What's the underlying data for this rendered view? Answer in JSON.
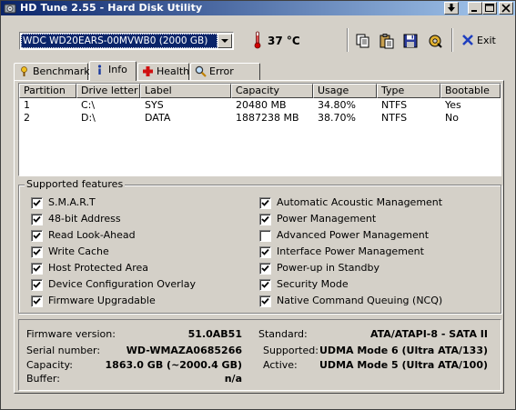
{
  "window": {
    "title": "HD Tune 2.55 - Hard Disk Utility",
    "buttons": [
      "down-arrow",
      "minimize",
      "maximize",
      "close"
    ]
  },
  "toolbar": {
    "drive_selected": "WDC WD20EARS-00MVWB0 (2000 GB)",
    "temperature": "37 °C",
    "exit_label": "Exit"
  },
  "tabs": [
    {
      "label": "Benchmark",
      "icon": "benchmark-icon",
      "active": false
    },
    {
      "label": "Info",
      "icon": "info-icon",
      "active": true
    },
    {
      "label": "Health",
      "icon": "health-cross-icon",
      "active": false
    },
    {
      "label": "Error Scan",
      "icon": "magnifier-icon",
      "active": false
    }
  ],
  "partitions": {
    "columns": [
      "Partition",
      "Drive letter",
      "Label",
      "Capacity",
      "Usage",
      "Type",
      "Bootable"
    ],
    "rows": [
      [
        "1",
        "C:\\",
        "SYS",
        "20480 MB",
        "34.80%",
        "NTFS",
        "Yes"
      ],
      [
        "2",
        "D:\\",
        "DATA",
        "1887238 MB",
        "38.70%",
        "NTFS",
        "No"
      ]
    ]
  },
  "features": {
    "title": "Supported features",
    "left": [
      {
        "label": "S.M.A.R.T",
        "checked": true
      },
      {
        "label": "48-bit Address",
        "checked": true
      },
      {
        "label": "Read Look-Ahead",
        "checked": true
      },
      {
        "label": "Write Cache",
        "checked": true
      },
      {
        "label": "Host Protected Area",
        "checked": true
      },
      {
        "label": "Device Configuration Overlay",
        "checked": true
      },
      {
        "label": "Firmware Upgradable",
        "checked": true
      }
    ],
    "right": [
      {
        "label": "Automatic Acoustic Management",
        "checked": true
      },
      {
        "label": "Power Management",
        "checked": true
      },
      {
        "label": "Advanced Power Management",
        "checked": false
      },
      {
        "label": "Interface Power Management",
        "checked": true
      },
      {
        "label": "Power-up in Standby",
        "checked": true
      },
      {
        "label": "Security Mode",
        "checked": true
      },
      {
        "label": "Native Command Queuing (NCQ)",
        "checked": true
      }
    ]
  },
  "info": {
    "firmware_label": "Firmware version:",
    "firmware": "51.0AB51",
    "serial_label": "Serial number:",
    "serial": "WD-WMAZA0685266",
    "capacity_label": "Capacity:",
    "capacity": "1863.0 GB (~2000.4 GB)",
    "buffer_label": "Buffer:",
    "buffer": "n/a",
    "standard_label": "Standard:",
    "standard": "ATA/ATAPI-8 - SATA II",
    "supported_label": "Supported:",
    "supported": "UDMA Mode 6 (Ultra ATA/133)",
    "active_label": "Active:",
    "active": "UDMA Mode 5 (Ultra ATA/100)"
  }
}
